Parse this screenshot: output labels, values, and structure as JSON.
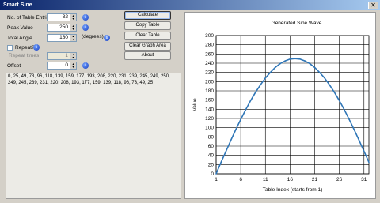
{
  "window": {
    "title": "Smart Sine",
    "close_glyph": "✕"
  },
  "fields": {
    "entries_label": "No. of Table Entries",
    "entries_value": "32",
    "peak_label": "Peak Value",
    "peak_value": "250",
    "angle_label": "Total Angle",
    "angle_value": "180",
    "angle_unit": "(degrees)",
    "repeat_label": "Repeat?",
    "repeat_times_label": "Repeat times",
    "repeat_times_value": "1",
    "offset_label": "Offset",
    "offset_value": "0"
  },
  "buttons": {
    "calculate": "Calculate",
    "copy_table": "Copy Table",
    "clear_table": "Clear Table",
    "clear_graph": "Clear Graph Area",
    "about": "About"
  },
  "icons": {
    "info": "info-icon",
    "spin_up": "▲",
    "spin_down": "▼",
    "info_glyph": "i"
  },
  "output_text": "0, 25, 49, 73, 96, 118, 139, 159, 177, 193, 208, 220, 231, 239, 245, 249, 250, 249, 245, 239, 231, 220, 208, 193, 177, 159, 139, 118, 96, 73, 49, 25",
  "colors": {
    "accent": "#0a246a",
    "series": "#2e75b6"
  },
  "chart_data": {
    "type": "line",
    "title": "Generated Sine Wave",
    "xlabel": "Table Index (starts from 1)",
    "ylabel": "Value",
    "x": [
      1,
      2,
      3,
      4,
      5,
      6,
      7,
      8,
      9,
      10,
      11,
      12,
      13,
      14,
      15,
      16,
      17,
      18,
      19,
      20,
      21,
      22,
      23,
      24,
      25,
      26,
      27,
      28,
      29,
      30,
      31,
      32
    ],
    "values": [
      0,
      25,
      49,
      73,
      96,
      118,
      139,
      159,
      177,
      193,
      208,
      220,
      231,
      239,
      245,
      249,
      250,
      249,
      245,
      239,
      231,
      220,
      208,
      193,
      177,
      159,
      139,
      118,
      96,
      73,
      49,
      25
    ],
    "xticks": [
      1,
      6,
      11,
      16,
      21,
      26,
      31
    ],
    "yticks": [
      0,
      20,
      40,
      60,
      80,
      100,
      120,
      140,
      160,
      180,
      200,
      220,
      240,
      260,
      280,
      300
    ],
    "xlim": [
      1,
      32
    ],
    "ylim": [
      0,
      300
    ],
    "grid": true
  }
}
